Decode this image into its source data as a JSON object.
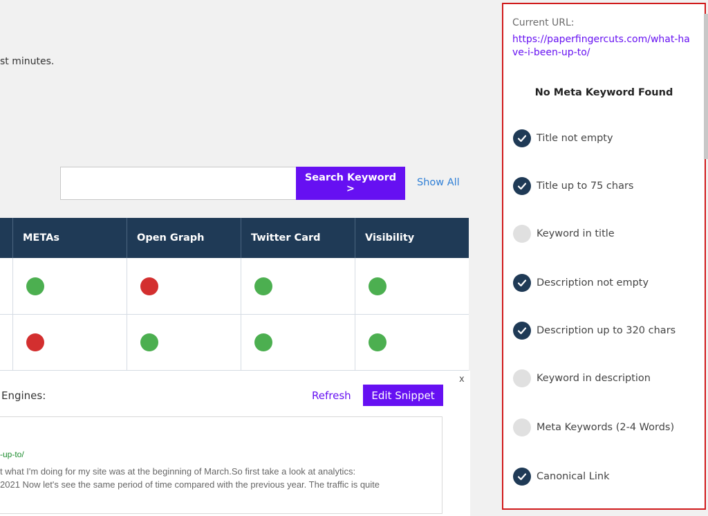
{
  "intro_text": "st minutes.",
  "search": {
    "value": "",
    "placeholder": "",
    "button_label": "Search Keyword >",
    "show_all_label": "Show All"
  },
  "table": {
    "headers": [
      "",
      "METAs",
      "Open Graph",
      "Twitter Card",
      "Visibility"
    ],
    "rows": [
      [
        "green",
        "red",
        "green",
        "green"
      ],
      [
        "red",
        "green",
        "green",
        "green"
      ]
    ]
  },
  "snippet": {
    "close_label": "x",
    "engines_label": "Engines:",
    "refresh_label": "Refresh",
    "edit_label": "Edit Snippet",
    "preview_url": "-up-to/",
    "preview_desc_lines": [
      "t what I'm doing for my site was at the beginning of March.So first take a look at analytics:",
      "2021 Now let's see the same period of time compared with the previous year. The traffic is quite"
    ]
  },
  "panel": {
    "url_label": "Current URL:",
    "url": "https://paperfingercuts.com/what-have-i-been-up-to/",
    "no_meta": "No Meta Keyword Found",
    "checks": [
      {
        "label": "Title not empty",
        "checked": true
      },
      {
        "label": "Title up to 75 chars",
        "checked": true
      },
      {
        "label": "Keyword in title",
        "checked": false
      },
      {
        "label": "Description not empty",
        "checked": true
      },
      {
        "label": "Description up to 320 chars",
        "checked": true
      },
      {
        "label": "Keyword in description",
        "checked": false
      },
      {
        "label": "Meta Keywords (2-4 Words)",
        "checked": false
      },
      {
        "label": "Canonical Link",
        "checked": true
      }
    ]
  },
  "colors": {
    "accent": "#6610f2",
    "header_bg": "#1f3a56",
    "green": "#4caf50",
    "red": "#d32f2f",
    "panel_border": "#d0191a"
  },
  "icons": {
    "check": "checkmark-icon"
  }
}
